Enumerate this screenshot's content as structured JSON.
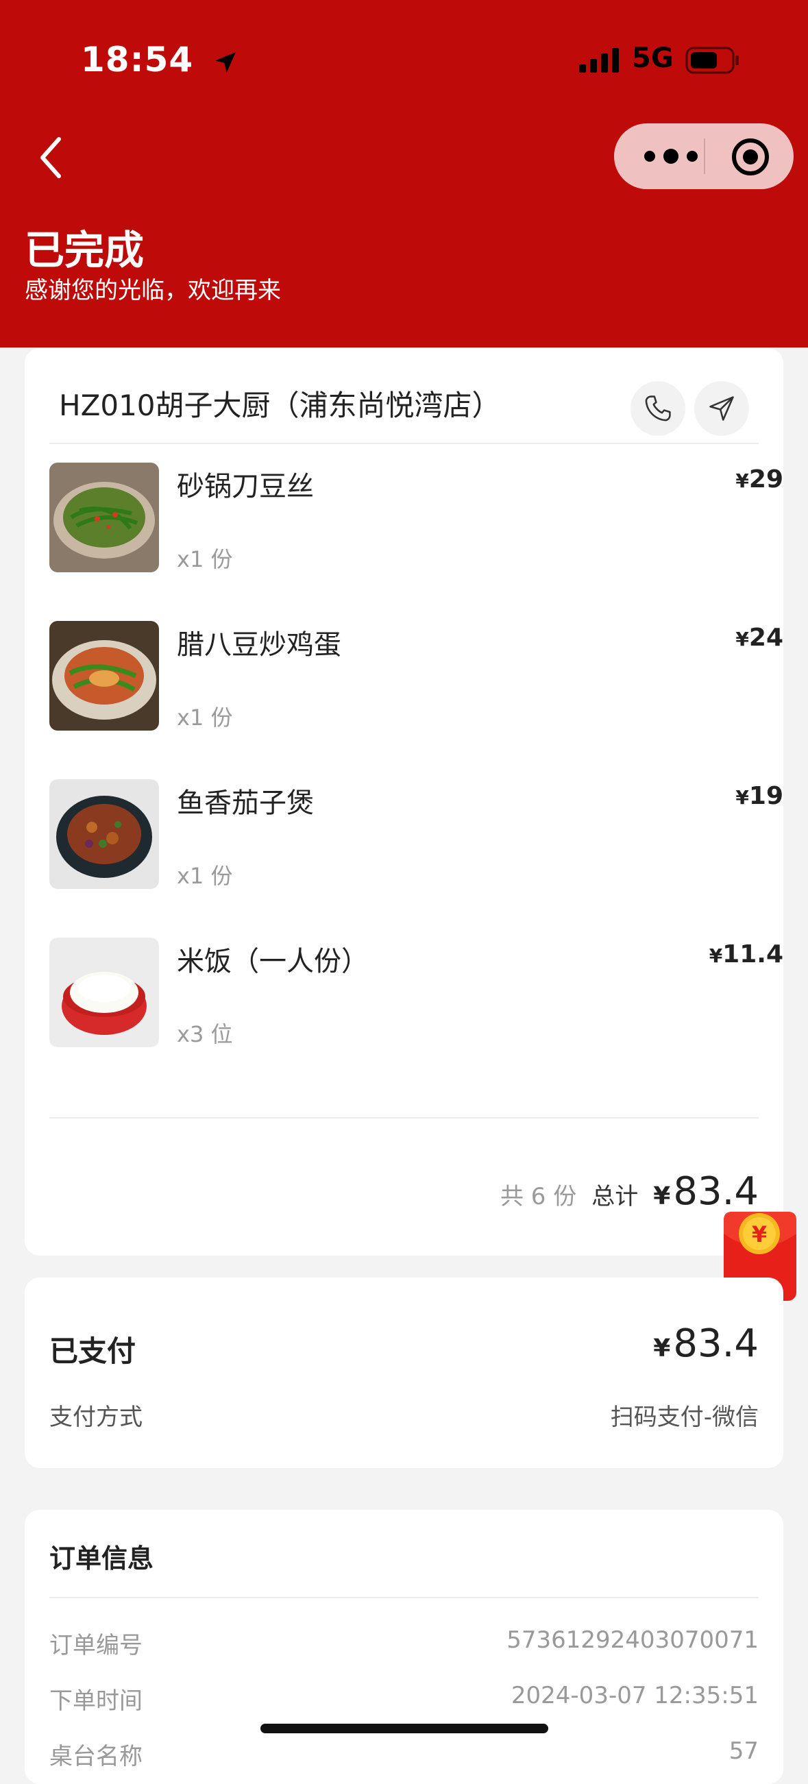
{
  "status_bar": {
    "time": "18:54",
    "network": "5G"
  },
  "header": {
    "title": "已完成",
    "subtitle": "感谢您的光临，欢迎再来"
  },
  "store": {
    "name": "HZ010胡子大厨（浦东尚悦湾店）",
    "items": [
      {
        "name": "砂锅刀豆丝",
        "qty": "x1 份",
        "currency": "¥",
        "price": "29"
      },
      {
        "name": "腊八豆炒鸡蛋",
        "qty": "x1 份",
        "currency": "¥",
        "price": "24"
      },
      {
        "name": "鱼香茄子煲",
        "qty": "x1 份",
        "currency": "¥",
        "price": "19"
      },
      {
        "name": "米饭（一人份）",
        "qty": "x3 位",
        "currency": "¥",
        "price": "11.4"
      }
    ],
    "count_text": "共 6 份",
    "total_label": "总计",
    "total_currency": "¥",
    "total_amount": "83.4"
  },
  "payment": {
    "paid_label": "已支付",
    "currency": "¥",
    "amount": "83.4",
    "method_label": "支付方式",
    "method_value": "扫码支付-微信"
  },
  "order_info": {
    "title": "订单信息",
    "rows": [
      {
        "label": "订单编号",
        "value": "57361292403070071"
      },
      {
        "label": "下单时间",
        "value": "2024-03-07 12:35:51"
      },
      {
        "label": "桌台名称",
        "value": "57"
      }
    ]
  },
  "colors": {
    "brand_red": "#bf0a0a",
    "background": "#f3f3f3"
  },
  "icons": [
    "back-icon",
    "more-icon",
    "target-icon",
    "phone-icon",
    "navigation-icon",
    "red-packet-icon",
    "location-arrow-icon"
  ]
}
